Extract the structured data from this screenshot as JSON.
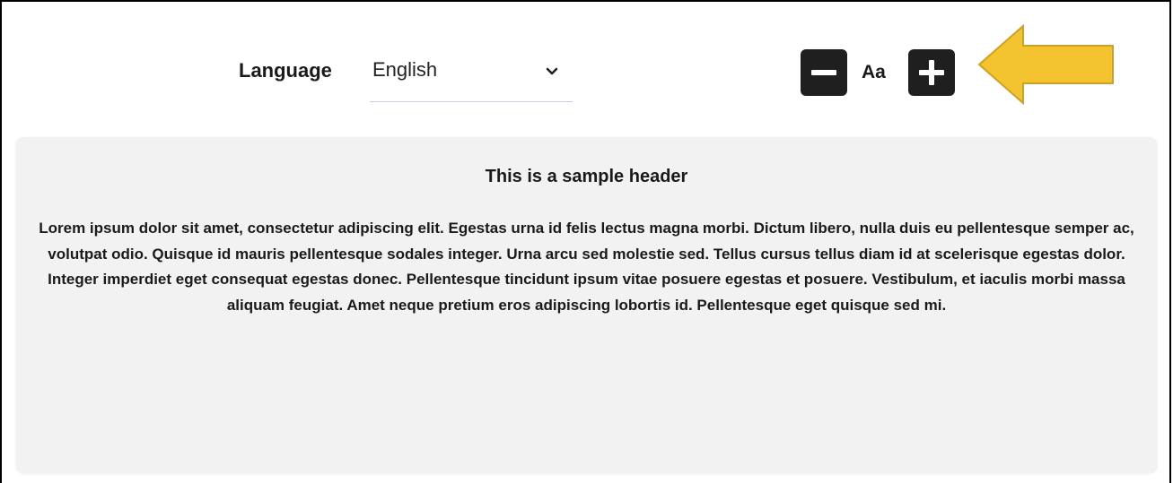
{
  "toolbar": {
    "language_label": "Language",
    "language_selected": "English",
    "text_size_label": "Aa",
    "decrease_icon": "minus-icon",
    "increase_icon": "plus-icon",
    "chevron_icon": "chevron-down-icon"
  },
  "annotation": {
    "icon": "arrow-left-icon",
    "fill_color": "#F4C430",
    "stroke_color": "#C9A227"
  },
  "content": {
    "header": "This is a sample header",
    "body": "Lorem ipsum dolor sit amet, consectetur adipiscing elit. Egestas urna id felis lectus magna morbi. Dictum libero, nulla duis eu pellentesque semper ac, volutpat odio. Quisque id mauris pellentesque sodales integer. Urna arcu sed molestie sed. Tellus cursus tellus diam id at scelerisque egestas dolor. Integer imperdiet eget consequat egestas donec. Pellentesque tincidunt ipsum vitae posuere egestas et posuere. Vestibulum, et iaculis morbi massa aliquam feugiat. Amet neque pretium eros adipiscing lobortis id. Pellentesque eget quisque sed mi."
  },
  "colors": {
    "button_bg": "#1F1F1F",
    "card_bg": "#F2F2F2",
    "select_underline": "#C9CCF0"
  }
}
